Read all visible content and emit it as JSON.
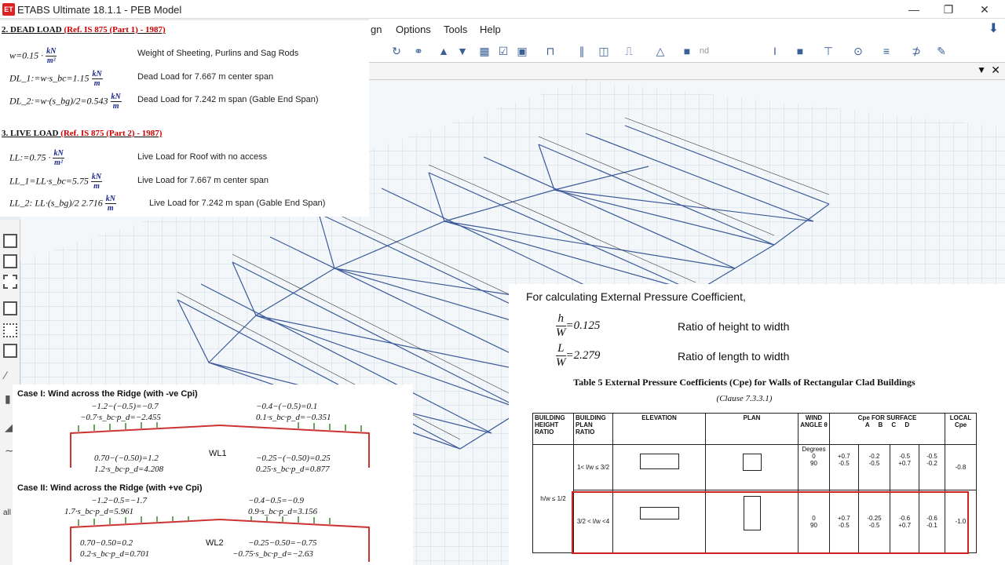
{
  "window": {
    "title": "ETABS Ultimate 18.1.1 - PEB Model",
    "app_icon": "ET"
  },
  "menu": {
    "items": [
      "gn",
      "Options",
      "Tools",
      "Help"
    ]
  },
  "dead_load": {
    "heading": "2. DEAD LOAD",
    "ref": "(Ref. IS 875 (Part 1) - 1987)",
    "rows": [
      {
        "lhs": "w=0.15 ·",
        "num": "kN",
        "den": "m²",
        "desc": "Weight of Sheeting, Purlins and Sag Rods"
      },
      {
        "lhs": "DL_1:=w·s_bc=1.15",
        "num": "kN",
        "den": "m",
        "desc": "Dead Load for 7.667 m center span"
      },
      {
        "lhs": "DL_2:=w·(s_bg)/2=0.543",
        "num": "kN",
        "den": "m",
        "desc": "Dead Load for 7.242 m span (Gable End Span)"
      }
    ]
  },
  "live_load": {
    "heading": "3. LIVE LOAD",
    "ref": "(Ref. IS 875 (Part 2) - 1987)",
    "rows": [
      {
        "lhs": "LL:=0.75 ·",
        "num": "kN",
        "den": "m²",
        "desc": "Live Load for Roof with no access"
      },
      {
        "lhs": "LL_1=LL·s_bc=5.75",
        "num": "kN",
        "den": "m",
        "desc": "Live Load for 7.667 m center span"
      },
      {
        "lhs": "LL_2: LL·(s_bg)/2  2.716",
        "num": "kN",
        "den": "m",
        "desc": "Live Load for 7.242 m span (Gable End Span)"
      }
    ]
  },
  "pressure": {
    "intro": "For calculating External Pressure Coefficient,",
    "ratios": [
      {
        "lhs_num": "h",
        "lhs_den": "W",
        "value": "=0.125",
        "desc": "Ratio of height to width"
      },
      {
        "lhs_num": "L",
        "lhs_den": "W",
        "value": "=2.279",
        "desc": "Ratio of length to width"
      }
    ]
  },
  "table5": {
    "title": "Table 5 External Pressure Coefficients (Cpe) for Walls of Rectangular Clad Buildings",
    "clause": "(Clause 7.3.3.1)",
    "headers": [
      "BUILDING HEIGHT RATIO",
      "BUILDING PLAN RATIO",
      "ELEVATION",
      "PLAN",
      "WIND ANGLE θ",
      "Cpe FOR SURFACE",
      "LOCAL Cpe"
    ],
    "surfaces": [
      "A",
      "B",
      "C",
      "D"
    ],
    "row_label": "h/w ≤ 1/2",
    "rows": [
      {
        "plan_ratio": "1< l/w ≤ 3/2",
        "angles": [
          "Degrees",
          "0",
          "90"
        ],
        "A": [
          "",
          "+0.7",
          "-0.5"
        ],
        "B": [
          "",
          "-0.2",
          "-0.5"
        ],
        "C": [
          "",
          "-0.5",
          "+0.7"
        ],
        "D": [
          "",
          "-0.5",
          "-0.2"
        ],
        "local": "-0.8"
      },
      {
        "plan_ratio": "3/2 < l/w <4",
        "angles": [
          "",
          "0",
          "90"
        ],
        "A": [
          "",
          "+0.7",
          "-0.5"
        ],
        "B": [
          "",
          "-0.25",
          "-0.5"
        ],
        "C": [
          "",
          "-0.6",
          "+0.7"
        ],
        "D": [
          "",
          "-0.6",
          "-0.1"
        ],
        "local": "-1.0"
      }
    ]
  },
  "cases": [
    {
      "heading": "Case I: Wind across the Ridge (with -ve Cpi)",
      "eqs": [
        "−1.2−(−0.5)=−0.7",
        "−0.7·s_bc·p_d=−2.455",
        "−0.4−(−0.5)=0.1",
        "0.1·s_bc·p_d=−0.351",
        "0.70−(−0.50)=1.2",
        "1.2·s_bc·p_d=4.208",
        "−0.25−(−0.50)=0.25",
        "0.25·s_bc·p_d=0.877"
      ],
      "label": "WL1"
    },
    {
      "heading": "Case II: Wind across the Ridge (with +ve Cpi)",
      "eqs": [
        "−1.2−0.5=−1.7",
        "1.7·s_bc·p_d=5.961",
        "−0.4−0.5=−0.9",
        "0.9·s_bc·p_d=3.156",
        "0.70−0.50=0.2",
        "0.2·s_bc·p_d=0.701",
        "−0.25−0.50=−0.75",
        "−0.75·s_bc·p_d=−2.63"
      ],
      "label": "WL2"
    }
  ],
  "colors": {
    "accent": "#2b5797",
    "ref": "#c00000",
    "frame": "#3c5a99",
    "grid": "#c8d4e4"
  }
}
